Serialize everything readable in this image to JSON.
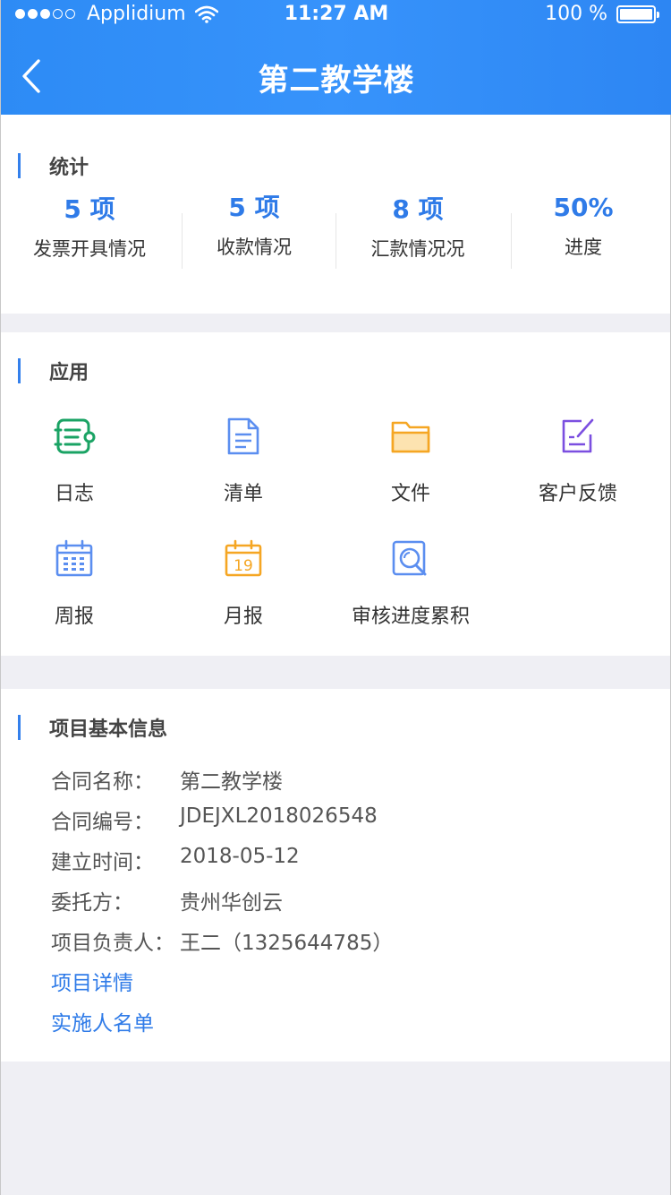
{
  "status_bar": {
    "carrier": "Applidium",
    "time": "11:27 AM",
    "battery": "100 %"
  },
  "nav": {
    "title": "第二教学楼"
  },
  "stats_section": {
    "title": "统计",
    "items": [
      {
        "value": "5 项",
        "label": "发票开具情况"
      },
      {
        "value": "5 项",
        "label": "收款情况"
      },
      {
        "value": "8 项",
        "label": "汇款情况况"
      },
      {
        "value": "50%",
        "label": "进度"
      }
    ]
  },
  "apps_section": {
    "title": "应用",
    "items": [
      {
        "label": "日志",
        "icon": "log-list-icon",
        "color": "#1aa364"
      },
      {
        "label": "清单",
        "icon": "document-icon",
        "color": "#5b8ef0"
      },
      {
        "label": "文件",
        "icon": "folder-icon",
        "color": "#f5a623"
      },
      {
        "label": "客户反馈",
        "icon": "edit-feedback-icon",
        "color": "#7b4fe0"
      },
      {
        "label": "周报",
        "icon": "calendar-week-icon",
        "color": "#5b8ef0"
      },
      {
        "label": "月报",
        "icon": "calendar-month-icon",
        "color": "#f5a623",
        "day": "19"
      },
      {
        "label": "审核进度累积",
        "icon": "review-search-icon",
        "color": "#5b8ef0"
      }
    ]
  },
  "info_section": {
    "title": "项目基本信息",
    "rows": [
      {
        "key": "合同名称：",
        "value": "第二教学楼"
      },
      {
        "key": "合同编号：",
        "value": "JDEJXL2018026548"
      },
      {
        "key": "建立时间：",
        "value": "2018-05-12"
      },
      {
        "key": "委托方：",
        "value": "贵州华创云"
      },
      {
        "key": "项目负责人：",
        "value": "王二（1325644785）"
      }
    ],
    "links": [
      {
        "label": "项目详情"
      },
      {
        "label": "实施人名单"
      }
    ]
  }
}
